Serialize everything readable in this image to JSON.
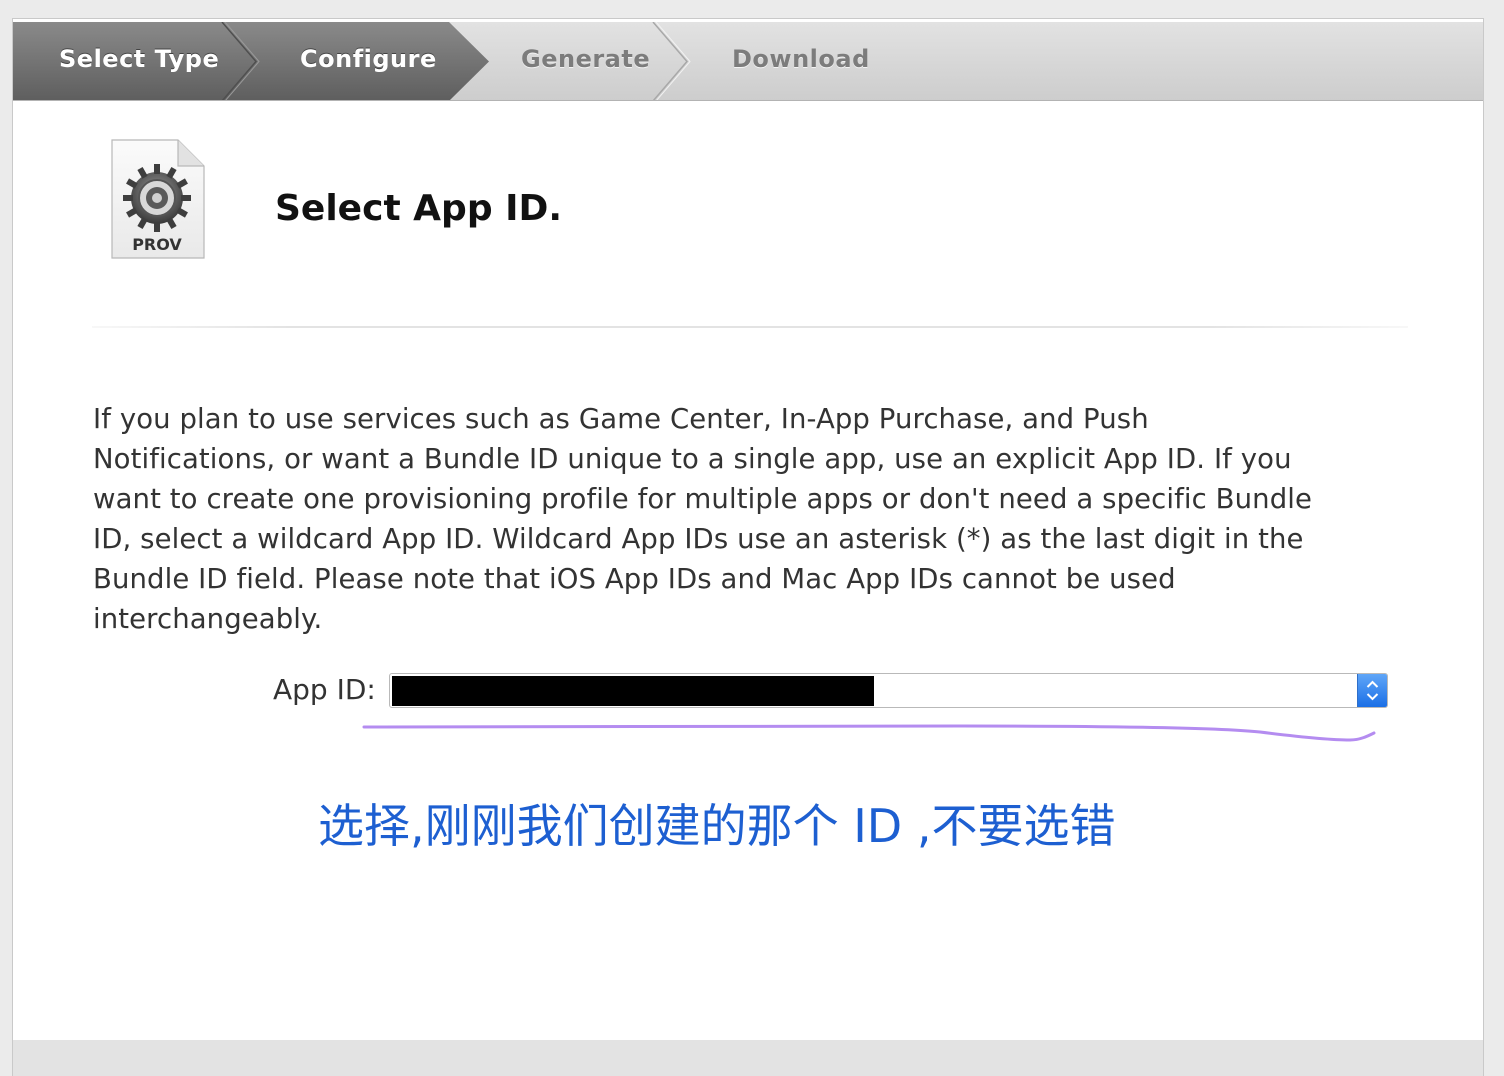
{
  "steps": [
    {
      "label": "Select Type",
      "state": "completed"
    },
    {
      "label": "Configure",
      "state": "current"
    },
    {
      "label": "Generate",
      "state": "upcoming"
    },
    {
      "label": "Download",
      "state": "upcoming"
    }
  ],
  "header": {
    "icon_label": "PROV",
    "icon_name": "provisioning-profile-gear-icon",
    "title": "Select App ID."
  },
  "description": "If you plan to use services such as Game Center, In-App Purchase, and Push Notifications, or want a Bundle ID unique to a single app, use an explicit App ID. If you want to create one provisioning profile for multiple apps or don't need a specific Bundle ID, select a wildcard App ID. Wildcard App IDs use an asterisk (*) as the last digit in the Bundle ID field. Please note that iOS App IDs and Mac App IDs cannot be used interchangeably.",
  "form": {
    "app_id_label": "App ID:",
    "app_id_value": "",
    "app_id_redacted": true,
    "stepper_icon": "up-down-chevron-icon"
  },
  "annotation": {
    "text": "选择,刚刚我们创建的那个 ID ,不要选错",
    "color": "#1d5fd1",
    "underline_color": "#b48cf0"
  },
  "colors": {
    "active_step_bg": "#707070",
    "inactive_step_text": "#7c7c7c",
    "select_accent": "#2f7cf0"
  }
}
